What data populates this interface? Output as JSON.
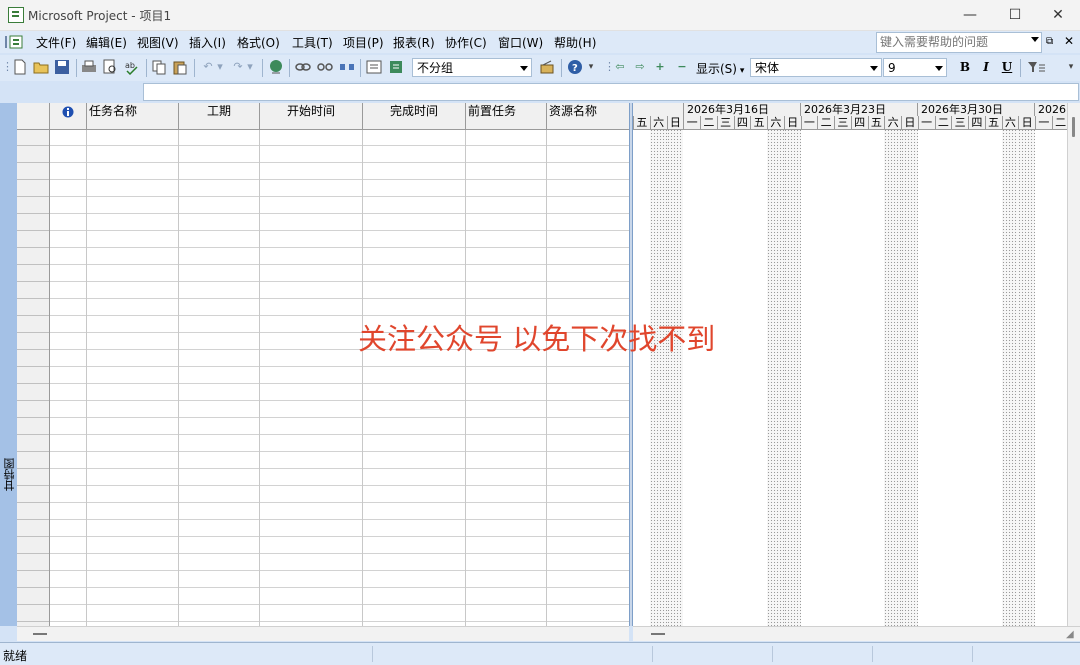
{
  "window": {
    "title": "Microsoft Project - 项目1",
    "minimize": "—",
    "maximize": "☐",
    "close": "✕"
  },
  "menu": {
    "items": [
      "文件(F)",
      "编辑(E)",
      "视图(V)",
      "插入(I)",
      "格式(O)",
      "工具(T)",
      "项目(P)",
      "报表(R)",
      "协作(C)",
      "窗口(W)",
      "帮助(H)"
    ],
    "help_placeholder": "键入需要帮助的问题"
  },
  "toolbar": {
    "group_by": "不分组",
    "display_label": "显示(S)",
    "font_name": "宋体",
    "font_size": "9",
    "bold": "B",
    "italic": "I",
    "underline": "U"
  },
  "view_bar": {
    "label": "甘特图"
  },
  "grid": {
    "columns": [
      "任务名称",
      "工期",
      "开始时间",
      "完成时间",
      "前置任务",
      "资源名称"
    ]
  },
  "gantt": {
    "weeks": [
      "2026年3月16日",
      "2026年3月23日",
      "2026年3月30日",
      "2026"
    ],
    "days": [
      "五",
      "六",
      "日",
      "一",
      "二",
      "三",
      "四",
      "五",
      "六",
      "日",
      "一",
      "二",
      "三",
      "四",
      "五",
      "六",
      "日",
      "一",
      "二",
      "三",
      "四",
      "五",
      "六",
      "日",
      "一",
      "二"
    ]
  },
  "status": {
    "text": "就绪"
  },
  "watermark": "关注公众号 以免下次找不到"
}
